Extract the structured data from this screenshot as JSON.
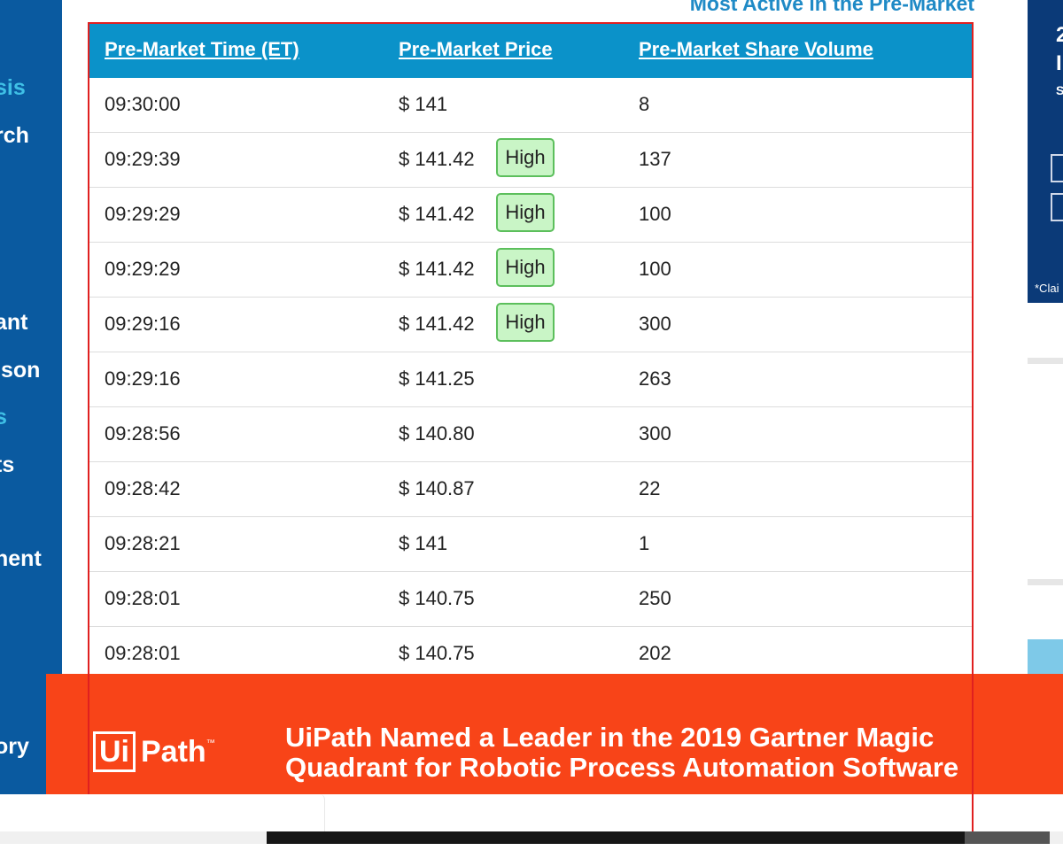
{
  "sidebar": {
    "items": [
      {
        "label": "sis"
      },
      {
        "label": "rch"
      },
      {
        "label": "ant"
      },
      {
        "label": "ison"
      },
      {
        "label": "s"
      },
      {
        "label": "ts"
      },
      {
        "label": "nent"
      },
      {
        "label": "ory"
      }
    ]
  },
  "title": "Most Active in the Pre-Market",
  "table": {
    "headers": [
      "Pre-Market Time (ET)",
      "Pre-Market Price",
      "Pre-Market Share Volume"
    ],
    "rows": [
      {
        "time": "09:30:00",
        "price": "$ 141",
        "badge": "",
        "volume": "8"
      },
      {
        "time": "09:29:39",
        "price": "$ 141.42",
        "badge": "High",
        "volume": "137"
      },
      {
        "time": "09:29:29",
        "price": "$ 141.42",
        "badge": "High",
        "volume": "100"
      },
      {
        "time": "09:29:29",
        "price": "$ 141.42",
        "badge": "High",
        "volume": "100"
      },
      {
        "time": "09:29:16",
        "price": "$ 141.42",
        "badge": "High",
        "volume": "300"
      },
      {
        "time": "09:29:16",
        "price": "$ 141.25",
        "badge": "",
        "volume": "263"
      },
      {
        "time": "09:28:56",
        "price": "$ 140.80",
        "badge": "",
        "volume": "300"
      },
      {
        "time": "09:28:42",
        "price": "$ 140.87",
        "badge": "",
        "volume": "22"
      },
      {
        "time": "09:28:21",
        "price": "$ 141",
        "badge": "",
        "volume": "1"
      },
      {
        "time": "09:28:01",
        "price": "$ 140.75",
        "badge": "",
        "volume": "250"
      },
      {
        "time": "09:28:01",
        "price": "$ 140.75",
        "badge": "",
        "volume": "202"
      }
    ]
  },
  "right_ad": {
    "glyph_1": "2",
    "glyph_2": "I",
    "glyph_3": "S",
    "claim": "*Clai"
  },
  "banner": {
    "logo_ui": "Ui",
    "logo_path": "Path",
    "logo_tm": "™",
    "headline": "UiPath Named a Leader in the 2019 Gartner Magic Quadrant for Robotic Process Automation Software"
  },
  "colors": {
    "header_bg": "#0b92c9",
    "sidebar_bg": "#0a5aa0",
    "banner_bg": "#f84418",
    "badge_bg": "#c9f5c6",
    "badge_border": "#5cbf5c",
    "highlight_border": "#e02020"
  }
}
